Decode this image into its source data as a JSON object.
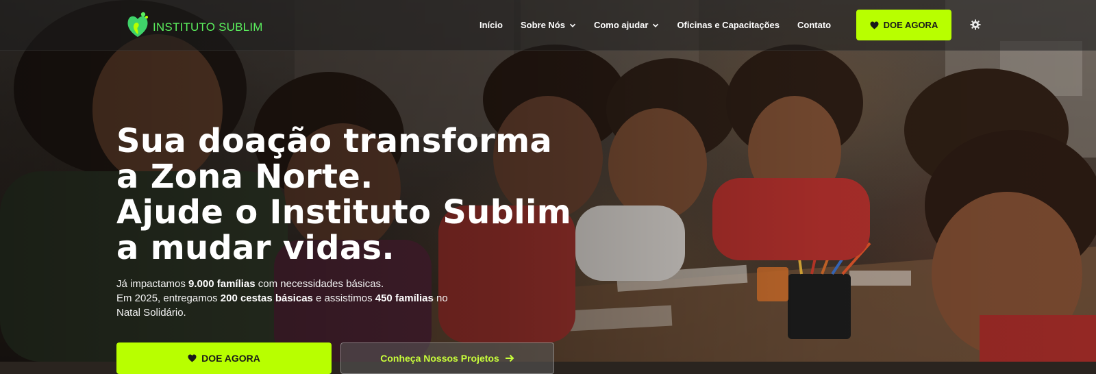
{
  "brand": {
    "name": "INSTITUTO SUBLIM",
    "accent_color": "#b8ff00",
    "logo_color": "#5bf05e"
  },
  "nav": {
    "items": [
      {
        "label": "Início",
        "has_dropdown": false
      },
      {
        "label": "Sobre Nós",
        "has_dropdown": true
      },
      {
        "label": "Como ajudar",
        "has_dropdown": true
      },
      {
        "label": "Oficinas e Capacitações",
        "has_dropdown": false
      },
      {
        "label": "Contato",
        "has_dropdown": false
      }
    ],
    "donate_label": "DOE AGORA",
    "settings_icon": "gear-icon"
  },
  "hero": {
    "headline_lines": [
      "Sua doação transforma",
      "a Zona Norte.",
      "Ajude o Instituto Sublim",
      "a mudar vidas."
    ],
    "stats": {
      "line1_prefix": "Já impactamos ",
      "line1_bold": "9.000 famílias",
      "line1_suffix": " com necessidades básicas.",
      "line2_prefix": "Em 2025, entregamos ",
      "line2_bold1": "200 cestas básicas",
      "line2_mid": " e assistimos ",
      "line2_bold2": "450 famílias",
      "line2_suffix": " no Natal Solidário."
    },
    "primary_button": "DOE AGORA",
    "secondary_button": "Conheça Nossos Projetos"
  }
}
